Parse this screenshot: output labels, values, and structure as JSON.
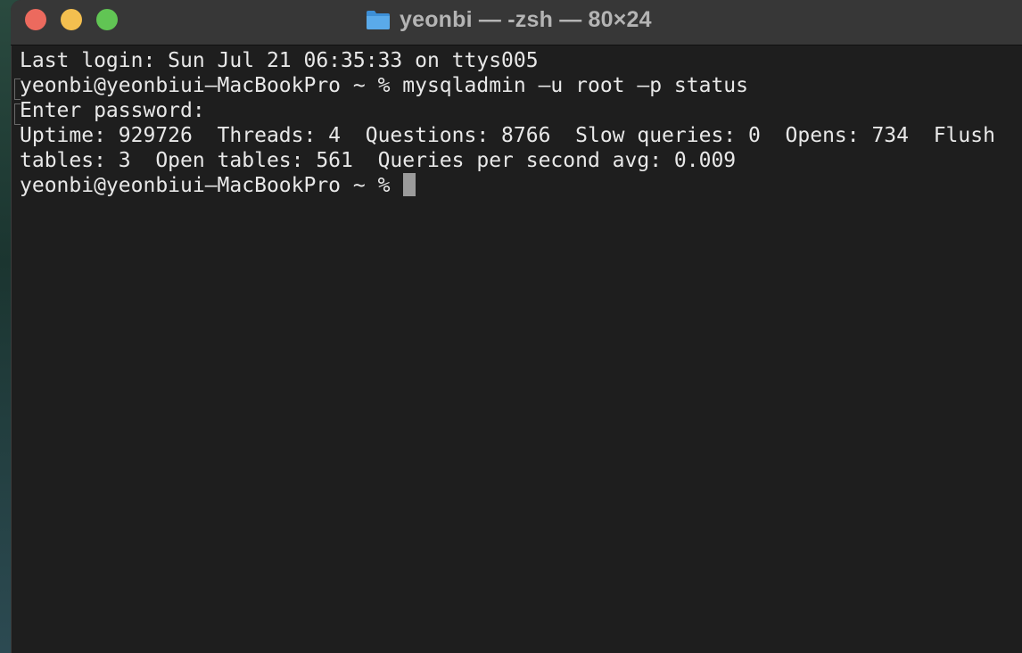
{
  "window": {
    "title": "yeonbi — -zsh — 80×24",
    "title_icon": "folder-icon",
    "controls": {
      "close": "close-button",
      "minimize": "minimize-button",
      "maximize": "maximize-button"
    }
  },
  "terminal": {
    "lines": [
      "Last login: Sun Jul 21 06:35:33 on ttys005",
      "yeonbi@yeonbiui—MacBookPro ~ % mysqladmin —u root —p status",
      "Enter password:",
      "Uptime: 929726  Threads: 4  Questions: 8766  Slow queries: 0  Opens: 734  Flush",
      "tables: 3  Open tables: 561  Queries per second avg: 0.009",
      "yeonbi@yeonbiui—MacBookPro ~ % "
    ]
  },
  "colors": {
    "background": "#1e1e1e",
    "titlebar": "#373737",
    "text": "#e8e8e8",
    "close": "#ec6a5e",
    "minimize": "#f4bf4f",
    "maximize": "#61c554",
    "folder": "#4a9fe0"
  }
}
